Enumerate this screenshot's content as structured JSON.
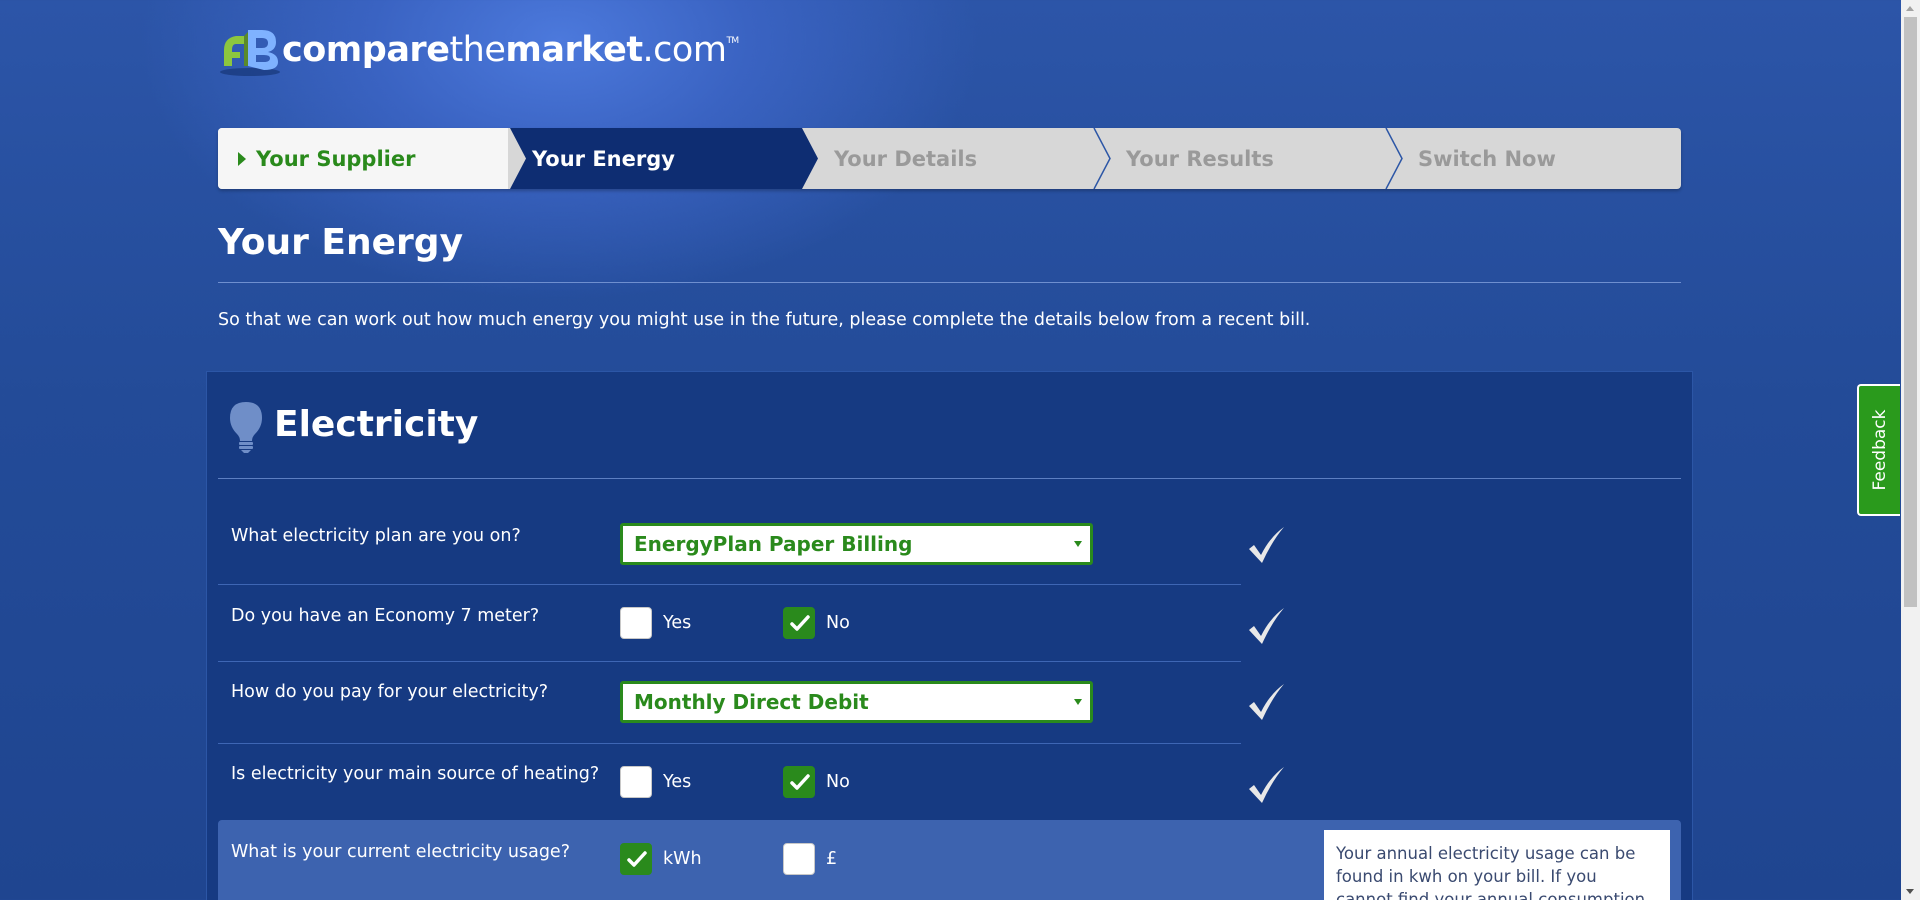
{
  "brand": {
    "compare": "compare",
    "the": "the",
    "market": "market",
    "com": ".com",
    "tm": "TM"
  },
  "progress": {
    "steps": [
      {
        "label": "Your Supplier",
        "state": "done"
      },
      {
        "label": "Your Energy",
        "state": "current"
      },
      {
        "label": "Your Details",
        "state": "upcoming"
      },
      {
        "label": "Your Results",
        "state": "upcoming"
      },
      {
        "label": "Switch Now",
        "state": "upcoming"
      }
    ]
  },
  "page": {
    "title": "Your Energy",
    "intro": "So that we can work out how much energy you might use in the future, please complete the details below from a recent bill."
  },
  "electricity": {
    "title": "Electricity",
    "icon": "lightbulb-icon",
    "plan": {
      "question": "What electricity plan are you on?",
      "value": "EnergyPlan Paper Billing"
    },
    "economy7": {
      "question": "Do you have an Economy 7 meter?",
      "yes": "Yes",
      "no": "No",
      "selected": "No"
    },
    "payment": {
      "question": "How do you pay for your electricity?",
      "value": "Monthly Direct Debit"
    },
    "heating": {
      "question": "Is electricity your main source of heating?",
      "yes": "Yes",
      "no": "No",
      "selected": "No"
    },
    "usage": {
      "question": "What is your current electricity usage?",
      "kwh": "kWh",
      "pound": "£",
      "selected": "kWh",
      "help": "Your annual electricity usage can be found in kwh on your bill. If you cannot find your annual consumption please"
    }
  },
  "feedback": "Feedback",
  "colors": {
    "accent_green": "#2a8a1c",
    "nav_active": "#0e2d72",
    "background": "#234b98"
  }
}
